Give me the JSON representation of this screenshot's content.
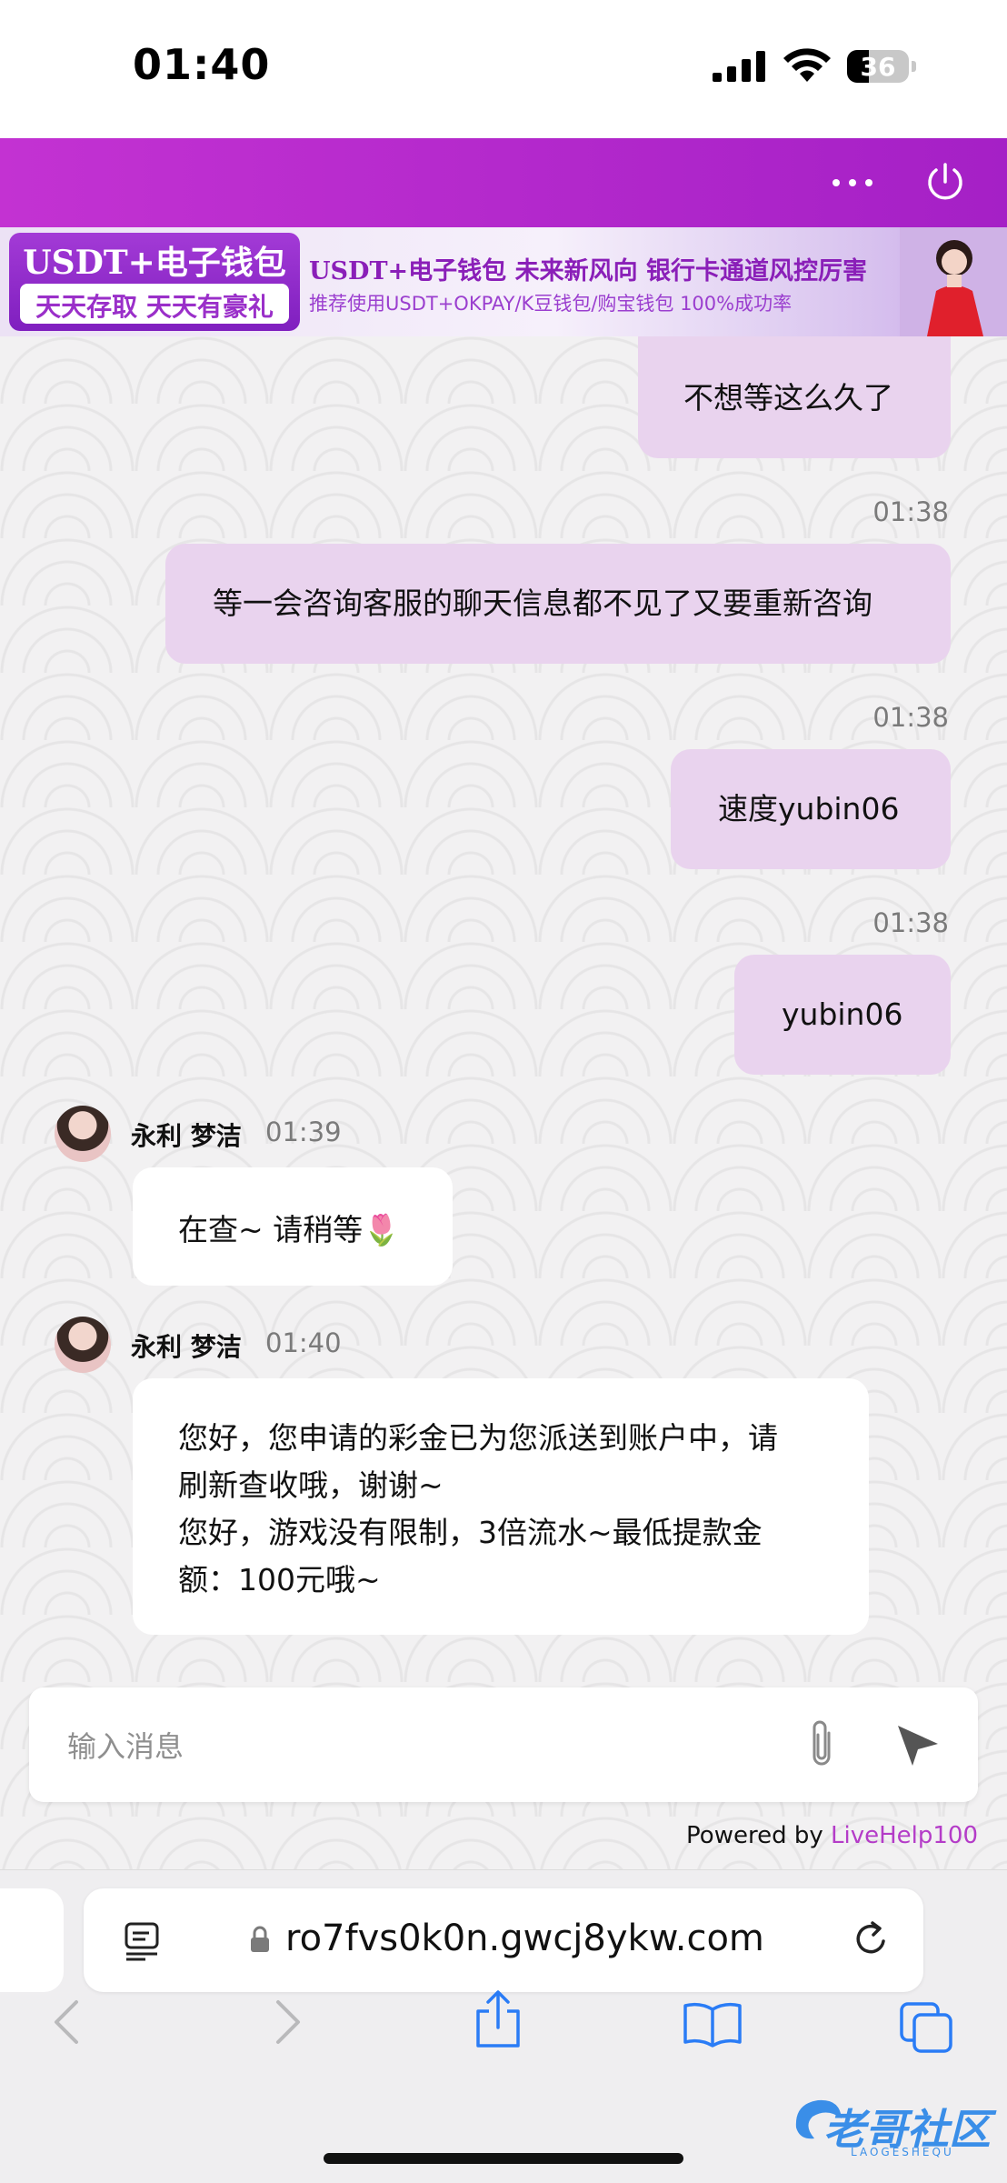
{
  "status_bar": {
    "time": "01:40",
    "battery": "36",
    "battery_level_percent": 36
  },
  "banner": {
    "left_line1": "USDT+电子钱包",
    "left_line2": "天天存取 天天有豪礼",
    "right_line1": "USDT+电子钱包  未来新风向  银行卡通道风控厉害",
    "right_line2": "推荐使用USDT+OKPAY/K豆钱包/购宝钱包  100%成功率"
  },
  "messages": {
    "out_1": "不想等这么久了",
    "ts_2": "01:38",
    "out_2": "等一会咨询客服的聊天信息都不见了又要重新咨询",
    "ts_3": "01:38",
    "out_3": "速度yubin06",
    "ts_4": "01:38",
    "out_4": "yubin06",
    "in_1": {
      "name": "永利 梦洁",
      "time": "01:39",
      "text": "在查~ 请稍等🌷"
    },
    "in_2": {
      "name": "永利 梦洁",
      "time": "01:40",
      "line1": "您好，您申请的彩金已为您派送到账户中，请",
      "line2": "刷新查收哦，谢谢~",
      "line3": "您好，游戏没有限制，3倍流水~最低提款金",
      "line4": "额：100元哦~"
    }
  },
  "composer": {
    "placeholder": "输入消息"
  },
  "powered_by": {
    "prefix": "Powered by ",
    "brand": "LiveHelp100"
  },
  "browser": {
    "url": "ro7fvs0k0n.gwcj8ykw.com"
  },
  "watermark": {
    "title": "老哥社区",
    "subtitle": "LAOGESHEQU"
  },
  "colors": {
    "header": "#b12bcc",
    "bubble_out": "#e9d3ee",
    "bubble_in": "#ffffff",
    "brand": "#b43cc8"
  }
}
